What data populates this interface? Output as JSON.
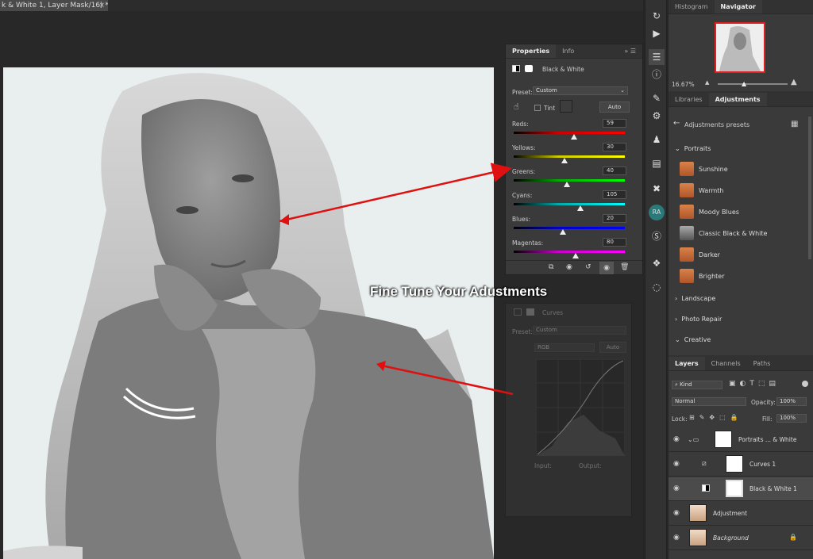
{
  "document": {
    "tab_title": "k & White 1, Layer Mask/16) *",
    "close": "×"
  },
  "annotation": "Fine Tune Your Adustments",
  "properties": {
    "tabs": [
      "Properties",
      "Info"
    ],
    "title": "Black & White",
    "preset_label": "Preset:",
    "preset_value": "Custom",
    "tint_label": "Tint",
    "auto_label": "Auto",
    "sliders": [
      {
        "label": "Reds:",
        "value": "59",
        "pos": 0.54
      },
      {
        "label": "Yellows:",
        "value": "30",
        "pos": 0.46
      },
      {
        "label": "Greens:",
        "value": "40",
        "pos": 0.48
      },
      {
        "label": "Cyans:",
        "value": "105",
        "pos": 0.6
      },
      {
        "label": "Blues:",
        "value": "20",
        "pos": 0.44
      },
      {
        "label": "Magentas:",
        "value": "80",
        "pos": 0.56
      }
    ]
  },
  "curves_ghost": {
    "title": "Curves",
    "preset_label": "Preset:",
    "preset_value": "Custom",
    "channel": "RGB",
    "auto_label": "Auto",
    "input_label": "Input:",
    "output_label": "Output:"
  },
  "navigator": {
    "tabs": [
      "Histogram",
      "Navigator"
    ],
    "zoom": "16.67%"
  },
  "adjustments": {
    "tabs": [
      "Libraries",
      "Adjustments"
    ],
    "header": "Adjustments presets",
    "open_group": "Portraits",
    "presets": [
      "Sunshine",
      "Warmth",
      "Moody Blues",
      "Classic Black & White",
      "Darker",
      "Brighter"
    ],
    "groups": [
      "Landscape",
      "Photo Repair",
      "Creative"
    ]
  },
  "layers_panel": {
    "tabs": [
      "Layers",
      "Channels",
      "Paths"
    ],
    "kind": "Kind",
    "blend": "Normal",
    "opacity_label": "Opacity:",
    "opacity": "100%",
    "lock_label": "Lock:",
    "fill_label": "Fill:",
    "fill": "100%",
    "layers": [
      {
        "name": "Portraits ... & White"
      },
      {
        "name": "Curves 1"
      },
      {
        "name": "Black & White 1"
      },
      {
        "name": "Adjustment"
      },
      {
        "name": "Background"
      }
    ]
  }
}
